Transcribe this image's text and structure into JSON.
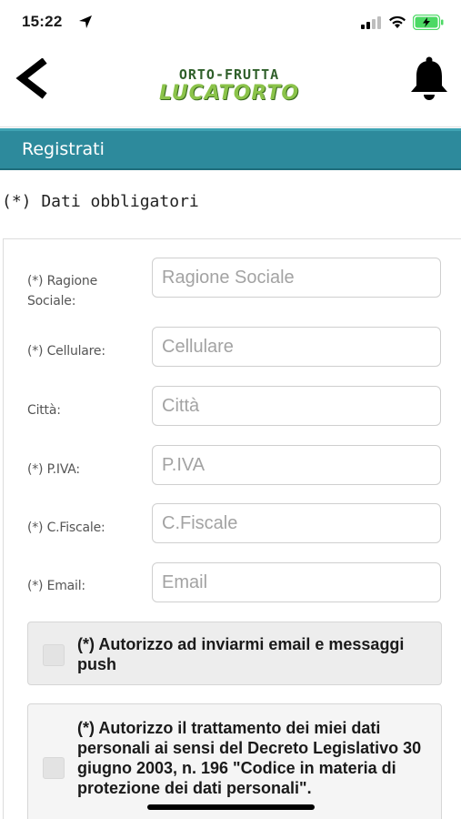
{
  "status_bar": {
    "time": "15:22",
    "icons": [
      "location-arrow-icon",
      "cellular-signal-icon",
      "wifi-icon",
      "battery-charging-icon"
    ],
    "battery_color": "#4cd964"
  },
  "header": {
    "logo_top": "ORTO-FRUTTA",
    "logo_bottom": "LUCATORTO",
    "icons": [
      "back-chevron-icon",
      "bell-icon"
    ]
  },
  "title_bar": {
    "label": "Registrati",
    "color": "#2d8a9c"
  },
  "required_note": "(*) Dati obbligatori",
  "form": {
    "fields": [
      {
        "label": "(*) Ragione Sociale:",
        "placeholder": "Ragione Sociale",
        "value": ""
      },
      {
        "label": "(*) Cellulare:",
        "placeholder": "Cellulare",
        "value": ""
      },
      {
        "label": "Città:",
        "placeholder": "Città",
        "value": ""
      },
      {
        "label": "(*) P.IVA:",
        "placeholder": "P.IVA",
        "value": ""
      },
      {
        "label": "(*) C.Fiscale:",
        "placeholder": "C.Fiscale",
        "value": ""
      },
      {
        "label": "(*) Email:",
        "placeholder": "Email",
        "value": ""
      }
    ],
    "consents": [
      {
        "text": "(*) Autorizzo ad inviarmi email e messaggi push",
        "checked": false
      },
      {
        "text": "(*) Autorizzo il trattamento dei miei dati personali ai sensi del Decreto Legislativo 30 giugno 2003, n. 196 \"Codice in materia di protezione dei dati personali\".",
        "checked": false
      }
    ]
  }
}
